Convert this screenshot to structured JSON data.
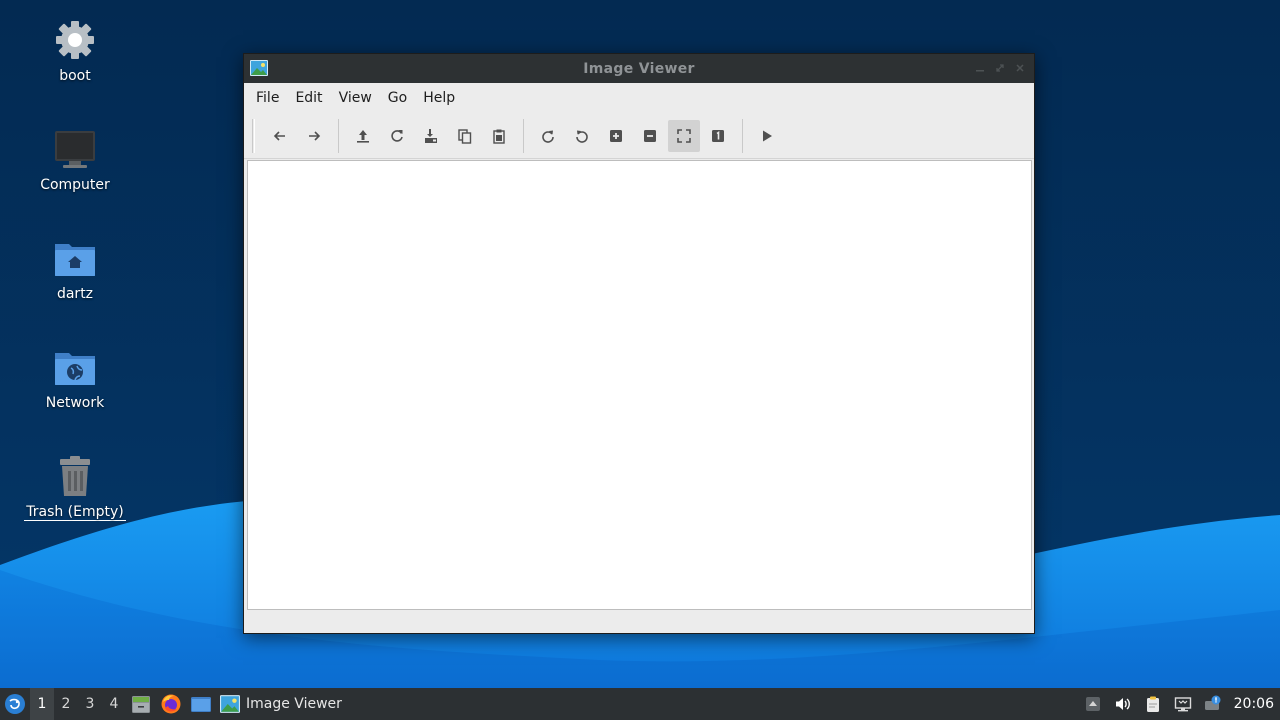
{
  "desktop": {
    "icons": [
      {
        "label": "boot"
      },
      {
        "label": "Computer"
      },
      {
        "label": "dartz"
      },
      {
        "label": "Network"
      },
      {
        "label": "Trash (Empty)"
      }
    ]
  },
  "window": {
    "title": "Image Viewer",
    "menu": [
      "File",
      "Edit",
      "View",
      "Go",
      "Help"
    ],
    "toolbar": [
      "back-icon",
      "forward-icon",
      "open-icon",
      "reload-icon",
      "save-as-icon",
      "copy-icon",
      "paste-icon",
      "rotate-clockwise-icon",
      "rotate-counterclockwise-icon",
      "zoom-in-icon",
      "zoom-out-icon",
      "fit-to-window-icon",
      "normal-size-icon",
      "slideshow-icon"
    ],
    "active_tool": "fit-to-window-icon"
  },
  "taskbar": {
    "workspaces": [
      "1",
      "2",
      "3",
      "4"
    ],
    "active_workspace": "1",
    "task_label": "Image Viewer",
    "clock": "20:06"
  },
  "colors": {
    "desktop_dark": "#032a52",
    "wave_light": "#1f9bf0",
    "titlebar": "#2d3133",
    "taskbar": "#2c3033",
    "folder_blue": "#4a90d9"
  }
}
